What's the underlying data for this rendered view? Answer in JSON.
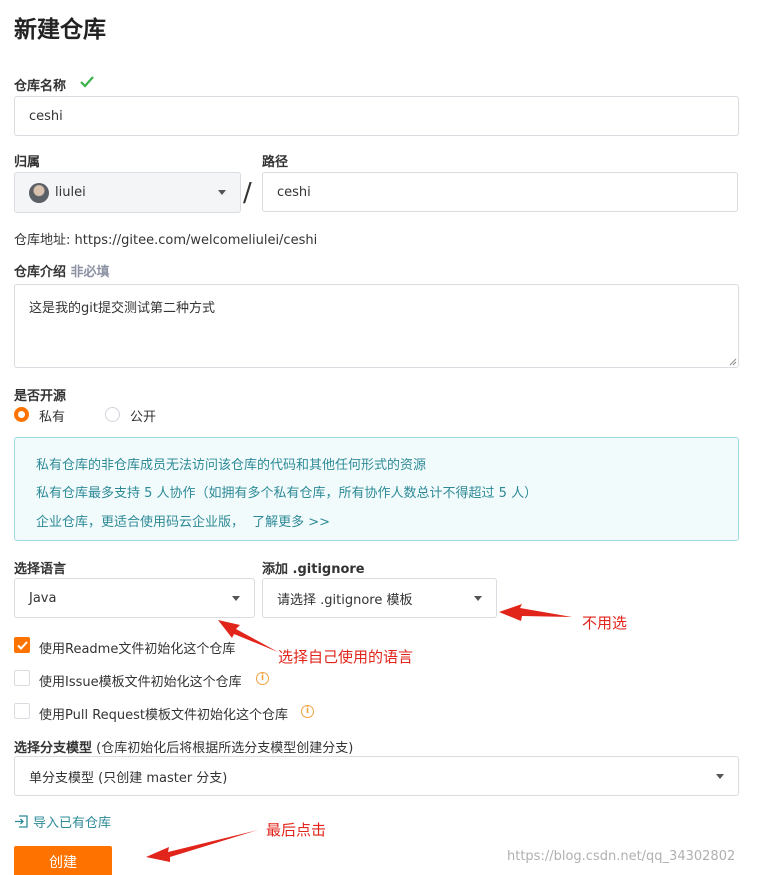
{
  "page": {
    "title": "新建仓库"
  },
  "repo_name": {
    "label": "仓库名称",
    "value": "ceshi"
  },
  "owner": {
    "label": "归属",
    "value": "liulei"
  },
  "separator": "/",
  "path": {
    "label": "路径",
    "value": "ceshi"
  },
  "repo_address": {
    "prefix": "仓库地址:",
    "url": "https://gitee.com/welcomeliulei/ceshi"
  },
  "description": {
    "label": "仓库介绍",
    "hint": "非必填",
    "value": "这是我的git提交测试第二种方式"
  },
  "visibility": {
    "label": "是否开源",
    "options": [
      {
        "label": "私有",
        "selected": true
      },
      {
        "label": "公开",
        "selected": false
      }
    ]
  },
  "private_notice": {
    "lines": [
      "私有仓库的非仓库成员无法访问该仓库的代码和其他任何形式的资源",
      "私有仓库最多支持 5 人协作（如拥有多个私有仓库，所有协作人数总计不得超过 5 人）"
    ],
    "enterprise_text": "企业仓库，更适合使用码云企业版，",
    "learn_more": "了解更多 >>"
  },
  "language": {
    "label": "选择语言",
    "value": "Java"
  },
  "gitignore": {
    "label": "添加 .gitignore",
    "value": "请选择 .gitignore 模板"
  },
  "init_options": [
    {
      "label": "使用Readme文件初始化这个仓库",
      "checked": true,
      "info": false
    },
    {
      "label": "使用Issue模板文件初始化这个仓库",
      "checked": false,
      "info": true
    },
    {
      "label": "使用Pull Request模板文件初始化这个仓库",
      "checked": false,
      "info": true
    }
  ],
  "branch_model": {
    "label": "选择分支模型",
    "hint": "(仓库初始化后将根据所选分支模型创建分支)",
    "value": "单分支模型 (只创建 master 分支)"
  },
  "import_link": "导入已有仓库",
  "create_button": "创建",
  "annotations": {
    "no_need": "不用选",
    "choose_language": "选择自己使用的语言",
    "finally_click": "最后点击"
  },
  "watermark": "https://blog.csdn.net/qq_34302802",
  "colors": {
    "accent": "#fe7300",
    "success": "#3bb24a",
    "annotation": "#e1251b",
    "notice_text": "#2d8a97"
  }
}
